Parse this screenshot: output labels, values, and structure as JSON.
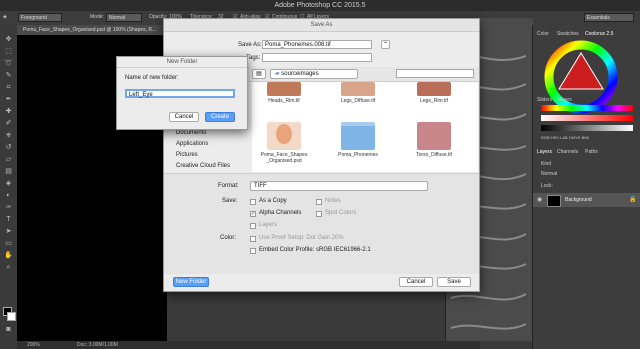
{
  "app": {
    "title": "Adobe Photoshop CC 2015.5"
  },
  "options_bar": {
    "preset": "Foreground",
    "mode_label": "Mode:",
    "mode_value": "Normal",
    "opacity_label": "Opacity:",
    "opacity_value": "100%",
    "tolerance_label": "Tolerance:",
    "tolerance_value": "32",
    "antialias": "Anti-alias",
    "contiguous": "Contiguous",
    "all_layers": "All Layers",
    "workspace": "Essentials"
  },
  "document": {
    "tab": "Poma_Face_Shapes_Organised.psd @ 100% (Shapes, R...",
    "status_zoom": "200%",
    "status_doc": "Doc: 3.00M/1.00M"
  },
  "right_panel": {
    "tabs_top": [
      "Color",
      "Swatches",
      "Coolorus 2.5"
    ],
    "tabs_mid": [
      "Sliders",
      "Mixers"
    ],
    "slider_mode": "RGB HSV LAB CMYK B/W",
    "tabs_layers": [
      "Layers",
      "Channels",
      "Paths"
    ],
    "kind_label": "Kind",
    "blend": "Normal",
    "lock_label": "Lock:",
    "layer_name": "Background",
    "wheel_colors": [
      "#ff0000",
      "#ffff00",
      "#00ff00",
      "#00ffff",
      "#0000ff",
      "#ff00ff"
    ]
  },
  "save_dialog": {
    "title": "Save As",
    "save_as_label": "Save As:",
    "filename": "Poma_Phonemes.008.tif",
    "tags_label": "Tags:",
    "location": "sourceimages",
    "sidebar": [
      "Documents",
      "Applications",
      "Pictures",
      "Creative Cloud Files"
    ],
    "files": [
      {
        "name": "Heads_Rim.tif",
        "color": "#c07a5a"
      },
      {
        "name": "Legs_Diffuse.tif",
        "color": "#d8a48a"
      },
      {
        "name": "Legs_Rim.tif",
        "color": "#b86e58"
      },
      {
        "name": "Poma_Face_Shapes\n_Organised.psd",
        "color": "#e9b99c"
      },
      {
        "name": "Poma_Phonemes",
        "color": "#7fb5e6"
      },
      {
        "name": "Torso_Diffuse.tif",
        "color": "#c9868a"
      }
    ],
    "format_label": "Format:",
    "format_value": "TIFF",
    "save_label": "Save:",
    "as_copy": "As a Copy",
    "notes": "Notes",
    "alpha_channels": "Alpha Channels",
    "spot_colors": "Spot Colors",
    "layers": "Layers",
    "color_label": "Color:",
    "use_proof": "Use Proof Setup:  Dot Gain 20%",
    "embed_profile": "Embed Color Profile:  sRGB IEC61966-2.1",
    "new_folder_button": "New Folder",
    "cancel_button": "Cancel",
    "save_button": "Save"
  },
  "new_folder_dialog": {
    "title": "New Folder",
    "prompt": "Name of new folder:",
    "value": "Left_Eye",
    "cancel_button": "Cancel",
    "create_button": "Create"
  }
}
